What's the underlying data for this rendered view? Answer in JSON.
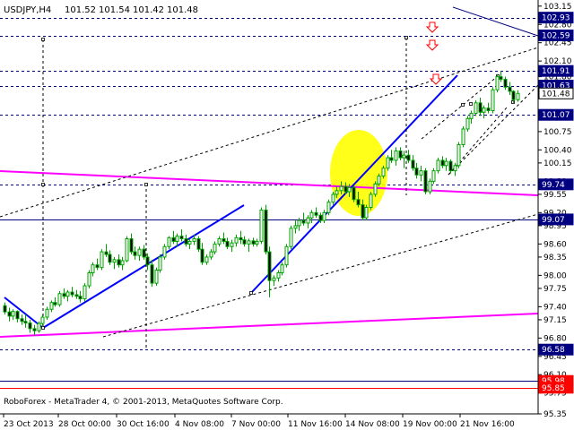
{
  "chart_data": {
    "type": "candlestick",
    "title": "USDJPY,H4",
    "header": {
      "symbol": "USDJPY,H4",
      "open": "101.52",
      "high": "101.54",
      "low": "101.42",
      "close": "101.48"
    },
    "copyright": "RoboForex - MetaTrader 4, © 2001-2013, MetaQuotes Software Corp.",
    "ylim": [
      95.35,
      103.25
    ],
    "y_ticks": [
      "103.15",
      "102.80",
      "102.45",
      "102.10",
      "101.80",
      "101.45",
      "101.10",
      "100.75",
      "100.40",
      "100.15",
      "99.80",
      "99.55",
      "99.20",
      "98.95",
      "98.60",
      "98.35",
      "98.00",
      "97.75",
      "97.40",
      "97.15",
      "96.80",
      "96.45",
      "96.10",
      "95.75",
      "95.35"
    ],
    "x_ticks": [
      "23 Oct 2013",
      "28 Oct 00:00",
      "30 Oct 16:00",
      "4 Nov 08:00",
      "7 Nov 00:00",
      "11 Nov 16:00",
      "14 Nov 08:00",
      "19 Nov 00:00",
      "21 Nov 16:00"
    ],
    "price_labels": [
      {
        "text": "102.93",
        "value": 102.93,
        "style": "box"
      },
      {
        "text": "102.59",
        "value": 102.59,
        "style": "box"
      },
      {
        "text": "101.91",
        "value": 101.91,
        "style": "box"
      },
      {
        "text": "101.63",
        "value": 101.63,
        "style": "box"
      },
      {
        "text": "101.48",
        "value": 101.48,
        "style": "current"
      },
      {
        "text": "101.07",
        "value": 101.07,
        "style": "box"
      },
      {
        "text": "99.74",
        "value": 99.74,
        "style": "box"
      },
      {
        "text": "99.07",
        "value": 99.07,
        "style": "box"
      },
      {
        "text": "96.58",
        "value": 96.58,
        "style": "box"
      },
      {
        "text": "95.98",
        "value": 95.98,
        "style": "red"
      },
      {
        "text": "95.85",
        "value": 95.85,
        "style": "red"
      }
    ],
    "horizontal_lines": [
      102.93,
      102.59,
      101.91,
      101.63,
      101.07,
      99.74,
      99.07,
      96.58,
      95.98
    ],
    "red_line": 95.85,
    "bar_count": 123,
    "candles": [
      [
        97.42,
        97.48,
        97.25,
        97.3
      ],
      [
        97.3,
        97.38,
        97.12,
        97.22
      ],
      [
        97.22,
        97.35,
        97.15,
        97.31
      ],
      [
        97.31,
        97.33,
        97.1,
        97.17
      ],
      [
        97.17,
        97.25,
        97.05,
        97.12
      ],
      [
        97.12,
        97.25,
        97.0,
        97.09
      ],
      [
        97.09,
        97.15,
        96.9,
        96.98
      ],
      [
        96.98,
        97.05,
        96.85,
        96.94
      ],
      [
        96.94,
        97.12,
        96.9,
        97.08
      ],
      [
        97.08,
        97.25,
        97.02,
        97.2
      ],
      [
        97.2,
        97.4,
        97.15,
        97.35
      ],
      [
        97.35,
        97.52,
        97.3,
        97.48
      ],
      [
        97.48,
        97.58,
        97.4,
        97.44
      ],
      [
        97.44,
        97.7,
        97.4,
        97.65
      ],
      [
        97.65,
        97.75,
        97.55,
        97.6
      ],
      [
        97.6,
        97.72,
        97.5,
        97.68
      ],
      [
        97.68,
        97.78,
        97.58,
        97.63
      ],
      [
        97.63,
        97.72,
        97.55,
        97.6
      ],
      [
        97.6,
        97.7,
        97.48,
        97.55
      ],
      [
        97.55,
        97.85,
        97.5,
        97.8
      ],
      [
        97.8,
        98.1,
        97.75,
        98.05
      ],
      [
        98.05,
        98.25,
        97.98,
        98.2
      ],
      [
        98.2,
        98.32,
        98.1,
        98.15
      ],
      [
        98.15,
        98.5,
        98.1,
        98.45
      ],
      [
        98.45,
        98.6,
        98.35,
        98.4
      ],
      [
        98.4,
        98.48,
        98.2,
        98.25
      ],
      [
        98.25,
        98.35,
        98.12,
        98.3
      ],
      [
        98.3,
        98.4,
        98.15,
        98.2
      ],
      [
        98.2,
        98.35,
        98.1,
        98.28
      ],
      [
        98.28,
        98.75,
        98.25,
        98.7
      ],
      [
        98.7,
        98.8,
        98.4,
        98.45
      ],
      [
        98.45,
        98.55,
        98.3,
        98.38
      ],
      [
        98.38,
        98.55,
        98.28,
        98.5
      ],
      [
        98.5,
        98.58,
        98.3,
        98.35
      ],
      [
        98.35,
        98.42,
        98.1,
        98.2
      ],
      [
        98.2,
        98.3,
        97.78,
        97.85
      ],
      [
        97.85,
        98.15,
        97.8,
        98.1
      ],
      [
        98.1,
        98.4,
        98.05,
        98.35
      ],
      [
        98.35,
        98.6,
        98.3,
        98.55
      ],
      [
        98.55,
        98.75,
        98.5,
        98.72
      ],
      [
        98.72,
        98.85,
        98.6,
        98.65
      ],
      [
        98.65,
        98.8,
        98.55,
        98.75
      ],
      [
        98.75,
        98.88,
        98.65,
        98.7
      ],
      [
        98.7,
        98.78,
        98.55,
        98.6
      ],
      [
        98.6,
        98.7,
        98.5,
        98.65
      ],
      [
        98.65,
        98.78,
        98.58,
        98.7
      ],
      [
        98.7,
        98.75,
        98.45,
        98.5
      ],
      [
        98.5,
        98.62,
        98.2,
        98.25
      ],
      [
        98.25,
        98.4,
        98.2,
        98.35
      ],
      [
        98.35,
        98.5,
        98.3,
        98.45
      ],
      [
        98.45,
        98.65,
        98.4,
        98.6
      ],
      [
        98.6,
        98.75,
        98.55,
        98.7
      ],
      [
        98.7,
        98.82,
        98.6,
        98.65
      ],
      [
        98.65,
        98.72,
        98.5,
        98.55
      ],
      [
        98.55,
        98.68,
        98.45,
        98.62
      ],
      [
        98.62,
        98.78,
        98.55,
        98.72
      ],
      [
        98.72,
        98.85,
        98.6,
        98.68
      ],
      [
        98.68,
        98.75,
        98.55,
        98.6
      ],
      [
        98.6,
        98.7,
        98.45,
        98.66
      ],
      [
        98.66,
        98.72,
        98.55,
        98.6
      ],
      [
        98.6,
        98.7,
        98.55,
        98.65
      ],
      [
        98.65,
        99.3,
        98.6,
        99.25
      ],
      [
        99.25,
        99.35,
        98.4,
        98.45
      ],
      [
        98.45,
        98.55,
        97.58,
        97.9
      ],
      [
        97.9,
        98.0,
        97.8,
        97.95
      ],
      [
        97.95,
        98.1,
        97.88,
        98.05
      ],
      [
        98.05,
        98.25,
        98.0,
        98.2
      ],
      [
        98.2,
        98.6,
        98.15,
        98.55
      ],
      [
        98.55,
        98.95,
        98.5,
        98.9
      ],
      [
        98.9,
        99.05,
        98.8,
        98.95
      ],
      [
        98.95,
        99.1,
        98.85,
        99.05
      ],
      [
        99.05,
        99.2,
        98.95,
        99.0
      ],
      [
        99.0,
        99.15,
        98.9,
        99.1
      ],
      [
        99.1,
        99.25,
        99.0,
        99.2
      ],
      [
        99.2,
        99.3,
        99.1,
        99.15
      ],
      [
        99.15,
        99.2,
        99.0,
        99.05
      ],
      [
        99.05,
        99.25,
        99.0,
        99.2
      ],
      [
        99.2,
        99.45,
        99.15,
        99.4
      ],
      [
        99.4,
        99.6,
        99.35,
        99.55
      ],
      [
        99.55,
        99.7,
        99.48,
        99.62
      ],
      [
        99.62,
        99.8,
        99.55,
        99.7
      ],
      [
        99.7,
        99.78,
        99.55,
        99.6
      ],
      [
        99.6,
        99.75,
        99.5,
        99.68
      ],
      [
        99.68,
        99.72,
        99.4,
        99.45
      ],
      [
        99.45,
        99.6,
        99.3,
        99.35
      ],
      [
        99.35,
        99.45,
        99.05,
        99.1
      ],
      [
        99.1,
        99.35,
        99.05,
        99.3
      ],
      [
        99.3,
        99.6,
        99.25,
        99.55
      ],
      [
        99.55,
        99.8,
        99.5,
        99.75
      ],
      [
        99.75,
        99.95,
        99.7,
        99.9
      ],
      [
        99.9,
        100.1,
        99.85,
        100.05
      ],
      [
        100.05,
        100.3,
        100.0,
        100.25
      ],
      [
        100.25,
        100.4,
        100.15,
        100.2
      ],
      [
        100.2,
        100.45,
        100.1,
        100.38
      ],
      [
        100.38,
        100.45,
        100.2,
        100.25
      ],
      [
        100.25,
        100.38,
        100.05,
        100.3
      ],
      [
        100.3,
        100.4,
        100.15,
        100.2
      ],
      [
        100.2,
        100.3,
        100.0,
        100.05
      ],
      [
        100.05,
        100.15,
        99.85,
        99.92
      ],
      [
        99.92,
        100.1,
        99.8,
        100.0
      ],
      [
        100.0,
        100.05,
        99.55,
        99.6
      ],
      [
        99.6,
        99.85,
        99.55,
        99.8
      ],
      [
        99.8,
        100.05,
        99.75,
        100.0
      ],
      [
        100.0,
        100.25,
        99.95,
        100.2
      ],
      [
        100.2,
        100.28,
        100.05,
        100.1
      ],
      [
        100.1,
        100.25,
        100.0,
        100.18
      ],
      [
        100.18,
        100.22,
        99.95,
        100.0
      ],
      [
        100.0,
        100.15,
        99.9,
        100.1
      ],
      [
        100.1,
        100.55,
        100.05,
        100.5
      ],
      [
        100.5,
        100.85,
        100.45,
        100.8
      ],
      [
        100.8,
        101.05,
        100.75,
        101.0
      ],
      [
        101.0,
        101.15,
        100.9,
        101.1
      ],
      [
        101.1,
        101.35,
        101.05,
        101.3
      ],
      [
        101.3,
        101.4,
        101.05,
        101.12
      ],
      [
        101.12,
        101.25,
        101.0,
        101.2
      ],
      [
        101.2,
        101.3,
        101.1,
        101.15
      ],
      [
        101.15,
        101.6,
        101.1,
        101.55
      ],
      [
        101.55,
        101.85,
        101.5,
        101.8
      ],
      [
        101.8,
        101.91,
        101.7,
        101.75
      ],
      [
        101.75,
        101.8,
        101.55,
        101.6
      ],
      [
        101.6,
        101.7,
        101.45,
        101.52
      ],
      [
        101.52,
        101.54,
        101.3,
        101.36
      ],
      [
        101.36,
        101.54,
        101.32,
        101.48
      ]
    ]
  }
}
